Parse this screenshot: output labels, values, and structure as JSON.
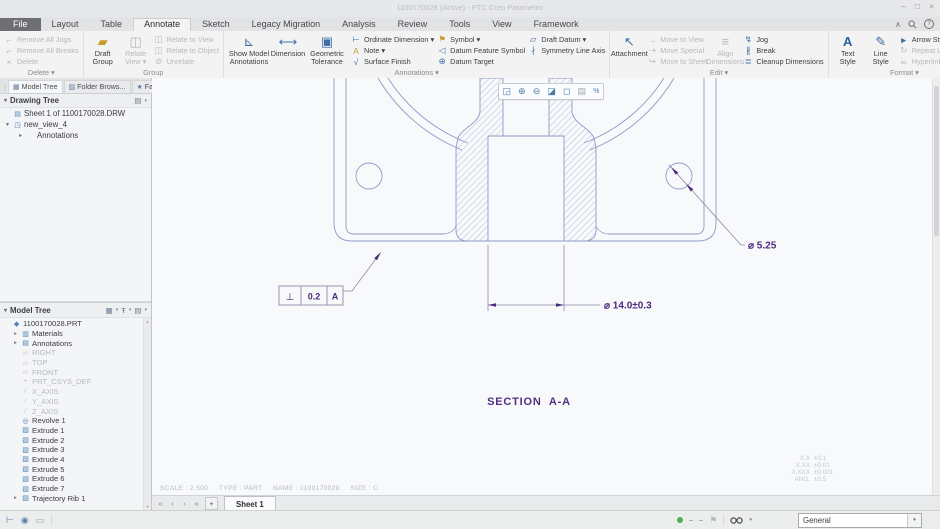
{
  "window": {
    "title": "1100170028 (Active) - PTC Creo Parametric",
    "min": "–",
    "max": "□",
    "close": "×"
  },
  "qat": {
    "app": "▣",
    "new": "▢",
    "open": "▤",
    "save": "▦",
    "undo": "↶",
    "redo": "↷",
    "arrow": "▾",
    "region": "▫",
    "gallery": "▨",
    "windows": "◳",
    "close": "×",
    "more": "▾"
  },
  "tabs": {
    "items": [
      {
        "label": "File",
        "cls": "file"
      },
      {
        "label": "Layout"
      },
      {
        "label": "Table"
      },
      {
        "label": "Annotate",
        "cls": "active"
      },
      {
        "label": "Sketch"
      },
      {
        "label": "Legacy Migration"
      },
      {
        "label": "Analysis"
      },
      {
        "label": "Review"
      },
      {
        "label": "Tools"
      },
      {
        "label": "View"
      },
      {
        "label": "Framework"
      }
    ],
    "collapse": "∧",
    "help": "?"
  },
  "ribbon": {
    "delete": {
      "label": "Delete ▾",
      "items": [
        {
          "label": "Remove All Jogs",
          "icon": "⌐"
        },
        {
          "label": "Remove All Breaks",
          "icon": "⌐"
        },
        {
          "label": "Delete",
          "icon": "×"
        }
      ]
    },
    "group": {
      "label": "Group",
      "big": [
        {
          "label": "Draft Group",
          "icon": "▰"
        },
        {
          "label": "Relate View ▾",
          "icon": "◫"
        }
      ],
      "items": [
        {
          "label": "Relate to View",
          "icon": "◫"
        },
        {
          "label": "Relate to Object",
          "icon": "◫"
        },
        {
          "label": "Unrelate",
          "icon": "⊘"
        }
      ]
    },
    "annotations": {
      "label": "Annotations ▾",
      "big": [
        {
          "label": "Show Model Annotations",
          "icon": "⊾"
        },
        {
          "label": "Dimension",
          "icon": "⟷"
        },
        {
          "label": "Geometric Tolerance",
          "icon": "▣"
        }
      ],
      "col1": [
        {
          "label": "Ordinate Dimension ▾",
          "icon": "⊢"
        },
        {
          "label": "Note ▾",
          "icon": "A"
        },
        {
          "label": "Surface Finish",
          "icon": "√"
        }
      ],
      "col2": [
        {
          "label": "Symbol ▾",
          "icon": "⚑"
        },
        {
          "label": "Datum Feature Symbol",
          "icon": "◁"
        },
        {
          "label": "Datum Target",
          "icon": "⊕"
        }
      ],
      "col3": [
        {
          "label": "Draft Datum ▾",
          "icon": "▱"
        },
        {
          "label": "Symmetry Line Axis",
          "icon": "∤"
        }
      ]
    },
    "edit": {
      "label": "Edit ▾",
      "big": [
        {
          "label": "Attachment",
          "icon": "↖"
        }
      ],
      "col1": [
        {
          "label": "Move to View",
          "icon": "→"
        },
        {
          "label": "Move Special",
          "icon": "⇢"
        },
        {
          "label": "Move to Sheet",
          "icon": "↪"
        }
      ],
      "align": {
        "label": "Align Dimensions",
        "icon": "≡"
      },
      "col2": [
        {
          "label": "Jog",
          "icon": "↯"
        },
        {
          "label": "Break",
          "icon": "∦"
        },
        {
          "label": "Cleanup Dimensions",
          "icon": "≣"
        }
      ]
    },
    "format": {
      "label": "Format ▾",
      "big": [
        {
          "label": "Text Style",
          "icon": "A"
        },
        {
          "label": "Line Style",
          "icon": "✎"
        }
      ],
      "col": [
        {
          "label": "Arrow Style ▾",
          "icon": "►"
        },
        {
          "label": "Repeat Last Format",
          "icon": "↻"
        },
        {
          "label": "Hyperlink",
          "icon": "∞"
        }
      ]
    }
  },
  "navigator": {
    "tabs": [
      {
        "label": "Model Tree",
        "icon": "▦",
        "cls": "active"
      },
      {
        "label": "Folder Brows...",
        "icon": "▨"
      },
      {
        "label": "Favorites",
        "icon": "★"
      }
    ],
    "drawing_tree": {
      "title": "Drawing Tree",
      "collapse": "▾",
      "items": [
        {
          "label": "Sheet 1 of 1100170028.DRW",
          "icon": "▤",
          "expand": " "
        },
        {
          "label": "new_view_4",
          "icon": "◳",
          "expand": "▾"
        },
        {
          "label": "Annotations",
          "icon": "",
          "expand": "▸",
          "cls": "ind2"
        }
      ]
    },
    "model_tree": {
      "title": "Model Tree",
      "collapse": "▾",
      "items": [
        {
          "label": "1100170028.PRT",
          "icon": "◆",
          "expand": "",
          "cls": "root"
        },
        {
          "label": "Materials",
          "icon": "▥",
          "expand": "▸"
        },
        {
          "label": "Annotations",
          "icon": "▤",
          "expand": "▸"
        },
        {
          "label": "RIGHT",
          "icon": "▱",
          "expand": " ",
          "cls": "dim"
        },
        {
          "label": "TOP",
          "icon": "▱",
          "expand": " ",
          "cls": "dim"
        },
        {
          "label": "FRONT",
          "icon": "▱",
          "expand": " ",
          "cls": "dim"
        },
        {
          "label": "PRT_CSYS_DEF",
          "icon": "+",
          "expand": " ",
          "cls": "dim"
        },
        {
          "label": "X_AXIS",
          "icon": "∕",
          "expand": " ",
          "cls": "dim"
        },
        {
          "label": "Y_AXIS",
          "icon": "∕",
          "expand": " ",
          "cls": "dim"
        },
        {
          "label": "Z_AXIS",
          "icon": "∕",
          "expand": " ",
          "cls": "dim"
        },
        {
          "label": "Revolve 1",
          "icon": "◎",
          "expand": " "
        },
        {
          "label": "Extrude 1",
          "icon": "▧",
          "expand": " "
        },
        {
          "label": "Extrude 2",
          "icon": "▧",
          "expand": " "
        },
        {
          "label": "Extrude 3",
          "icon": "▧",
          "expand": " "
        },
        {
          "label": "Extrude 4",
          "icon": "▧",
          "expand": " "
        },
        {
          "label": "Extrude 5",
          "icon": "▧",
          "expand": " "
        },
        {
          "label": "Extrude 6",
          "icon": "▧",
          "expand": " "
        },
        {
          "label": "Extrude 7",
          "icon": "▧",
          "expand": " "
        },
        {
          "label": "Trajectory Rib 1",
          "icon": "▨",
          "expand": "▸"
        }
      ]
    }
  },
  "drawing": {
    "toolbar": [
      {
        "glyph": "◲"
      },
      {
        "glyph": "⊕"
      },
      {
        "glyph": "⊖"
      },
      {
        "glyph": "◪"
      },
      {
        "glyph": "◻"
      },
      {
        "glyph": "▤"
      },
      {
        "glyph": "%"
      }
    ],
    "gtol": {
      "symbol": "⊥",
      "value": "0.2",
      "datum": "A"
    },
    "dims": {
      "bore": "⌀ 14.0±0.3",
      "hole": "⌀ 5.25"
    },
    "section_label": "SECTION  A-A",
    "tol_block": [
      {
        "k": "X.X",
        "v": "±0.1"
      },
      {
        "k": "X.XX",
        "v": "±0.01"
      },
      {
        "k": "X.XXX",
        "v": "±0.001"
      },
      {
        "k": "ANG.",
        "v": "±0.5"
      }
    ],
    "info": "SCALE : 2.500     TYPE : PART     NAME : 1100170028     SIZE : C"
  },
  "sheet_bar": {
    "first": "«",
    "prev": "‹",
    "next": "›",
    "last": "»",
    "add": "+",
    "tab": "Sheet 1"
  },
  "status": {
    "filter": "General"
  }
}
